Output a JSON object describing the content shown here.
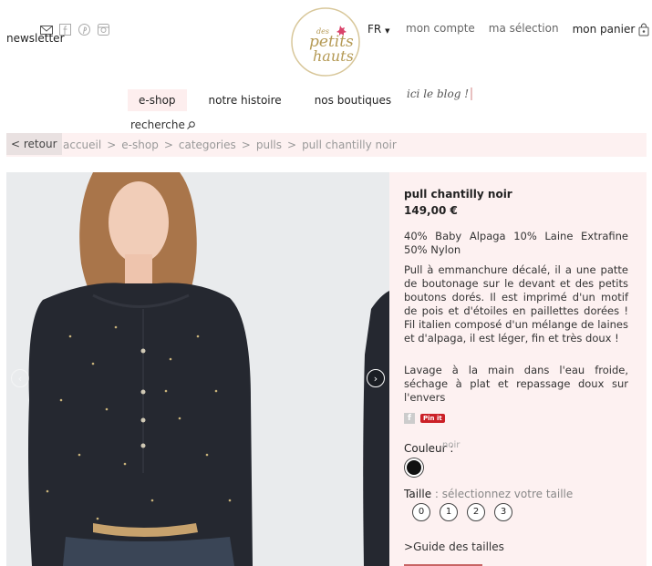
{
  "header": {
    "newsletter": "newsletter",
    "social": [
      "mail-icon",
      "facebook-icon",
      "pinterest-icon",
      "instagram-icon"
    ],
    "logo": {
      "line1": "des",
      "line2": "petits",
      "line3": "hauts"
    },
    "language": "FR",
    "account": "mon compte",
    "selection": "ma sélection",
    "cart": "mon panier"
  },
  "nav": {
    "items": [
      "e-shop",
      "notre histoire",
      "nos boutiques"
    ],
    "blog": "ici le blog !",
    "search_placeholder": "recherche"
  },
  "breadcrumb": {
    "back": "< retour",
    "items": [
      "accueil",
      "e-shop",
      "categories",
      "pulls",
      "pull chantilly noir"
    ]
  },
  "product": {
    "title": "pull chantilly noir",
    "price": "149,00 €",
    "composition": "40% Baby Alpaga 10% Laine Extrafine 50% Nylon",
    "description": "Pull à emmanchure décalé, il a une patte de boutonage sur le devant et des petits boutons dorés. Il est imprimé d'un motif de pois et d'étoiles en paillettes dorées ! Fil italien composé d'un mélange de laines et d'alpaga, il est léger, fin et très doux !",
    "care": "Lavage à la main dans l'eau froide, séchage à plat et repassage doux sur l'envers",
    "pinit": "Pin it",
    "color_label": "Couleur :",
    "color_name": "noir",
    "size_label": "Taille",
    "size_hint": " : sélectionnez votre taille",
    "sizes": [
      "0",
      "1",
      "2",
      "3"
    ],
    "size_guide": "Guide des tailles"
  },
  "colors": {
    "accent": "#fdf1f1",
    "swatch": "#111111",
    "pinterest": "#cb2027"
  }
}
